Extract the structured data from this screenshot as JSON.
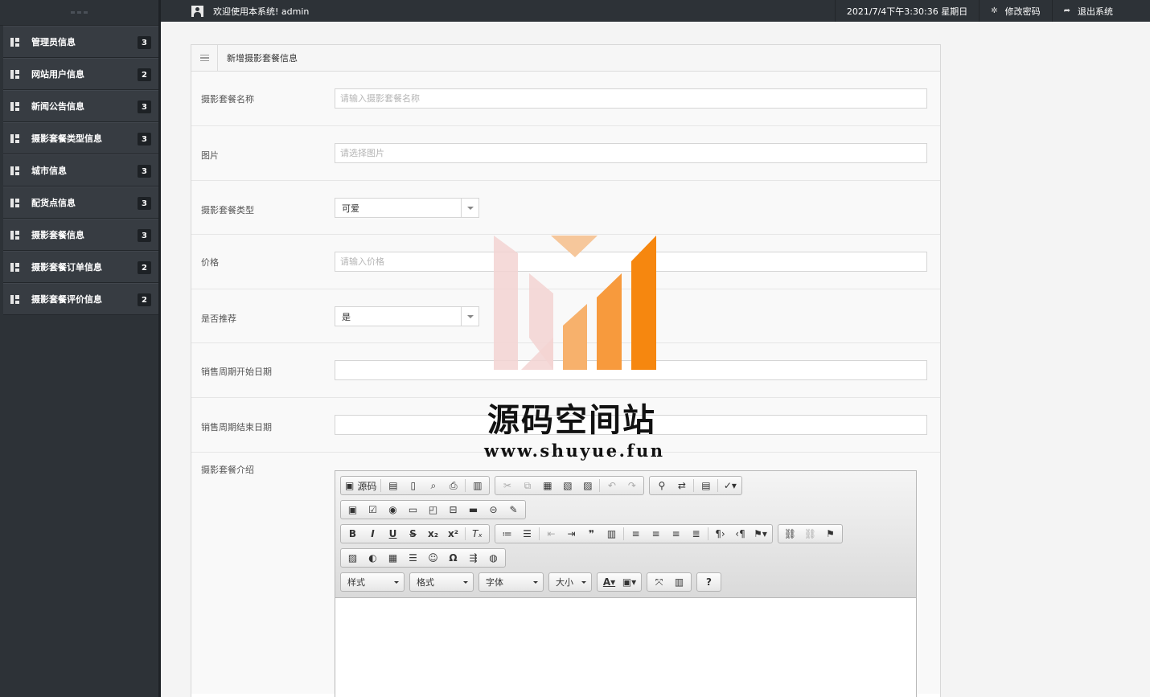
{
  "topbar": {
    "welcome": "欢迎使用本系统! admin",
    "datetime": "2021/7/4下午3:30:36 星期日",
    "change_password": "修改密码",
    "logout": "退出系统"
  },
  "sidebar": {
    "items": [
      {
        "label": "管理员信息",
        "count": "3"
      },
      {
        "label": "网站用户信息",
        "count": "2"
      },
      {
        "label": "新闻公告信息",
        "count": "3"
      },
      {
        "label": "摄影套餐类型信息",
        "count": "3"
      },
      {
        "label": "城市信息",
        "count": "3"
      },
      {
        "label": "配货点信息",
        "count": "3"
      },
      {
        "label": "摄影套餐信息",
        "count": "3"
      },
      {
        "label": "摄影套餐订单信息",
        "count": "2"
      },
      {
        "label": "摄影套餐评价信息",
        "count": "2"
      }
    ]
  },
  "panel": {
    "title": "新增摄影套餐信息"
  },
  "form": {
    "name": {
      "label": "摄影套餐名称",
      "placeholder": "请输入摄影套餐名称"
    },
    "image": {
      "label": "图片",
      "placeholder": "请选择图片"
    },
    "type": {
      "label": "摄影套餐类型",
      "value": "可爱"
    },
    "price": {
      "label": "价格",
      "placeholder": "请输入价格"
    },
    "recommend": {
      "label": "是否推荐",
      "value": "是"
    },
    "start_date": {
      "label": "销售周期开始日期"
    },
    "end_date": {
      "label": "销售周期结束日期"
    },
    "intro": {
      "label": "摄影套餐介绍"
    }
  },
  "editor": {
    "source_label": "源码",
    "style_combo": "样式",
    "format_combo": "格式",
    "font_combo": "字体",
    "size_combo": "大小",
    "help": "?"
  },
  "watermark": {
    "text": "源码空间站",
    "url": "www.shuyue.fun"
  }
}
